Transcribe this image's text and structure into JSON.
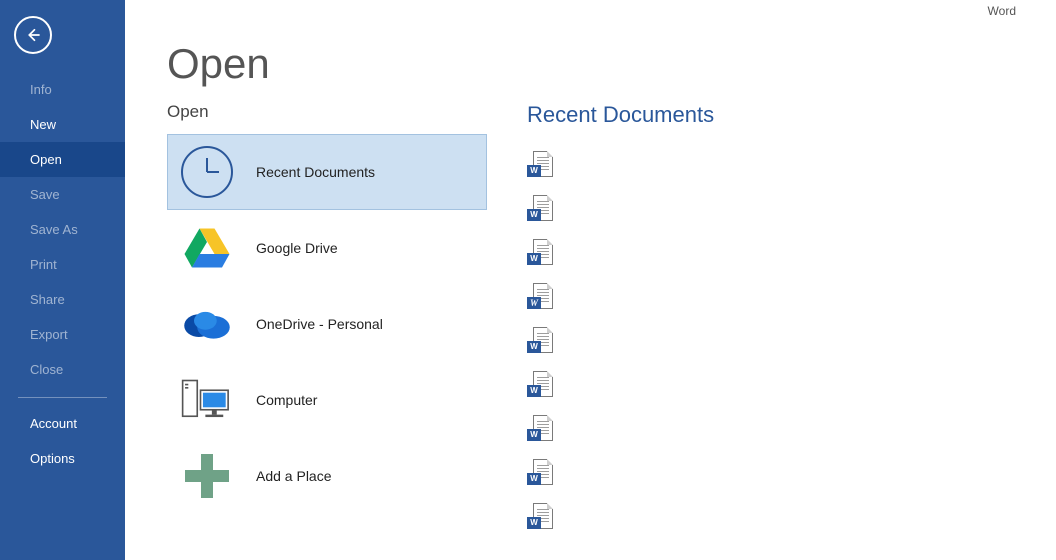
{
  "app_title": "Word",
  "page_title": "Open",
  "sidebar": {
    "items": [
      {
        "label": "Info",
        "state": "dim"
      },
      {
        "label": "New",
        "state": "normal"
      },
      {
        "label": "Open",
        "state": "selected"
      },
      {
        "label": "Save",
        "state": "dim"
      },
      {
        "label": "Save As",
        "state": "dim"
      },
      {
        "label": "Print",
        "state": "dim"
      },
      {
        "label": "Share",
        "state": "dim"
      },
      {
        "label": "Export",
        "state": "dim"
      },
      {
        "label": "Close",
        "state": "dim"
      }
    ],
    "footer": [
      {
        "label": "Account"
      },
      {
        "label": "Options"
      }
    ]
  },
  "places": {
    "title": "Open",
    "items": [
      {
        "label": "Recent Documents",
        "icon": "clock-icon",
        "selected": true
      },
      {
        "label": "Google Drive",
        "icon": "google-drive-icon",
        "selected": false
      },
      {
        "label": "OneDrive - Personal",
        "icon": "onedrive-icon",
        "selected": false
      },
      {
        "label": "Computer",
        "icon": "computer-icon",
        "selected": false
      },
      {
        "label": "Add a Place",
        "icon": "add-place-icon",
        "selected": false
      }
    ]
  },
  "recent": {
    "title": "Recent Documents",
    "docs": [
      {
        "type": "docx"
      },
      {
        "type": "docx"
      },
      {
        "type": "docx"
      },
      {
        "type": "doc"
      },
      {
        "type": "docx"
      },
      {
        "type": "docx"
      },
      {
        "type": "docx"
      },
      {
        "type": "docx"
      },
      {
        "type": "docx"
      }
    ]
  }
}
